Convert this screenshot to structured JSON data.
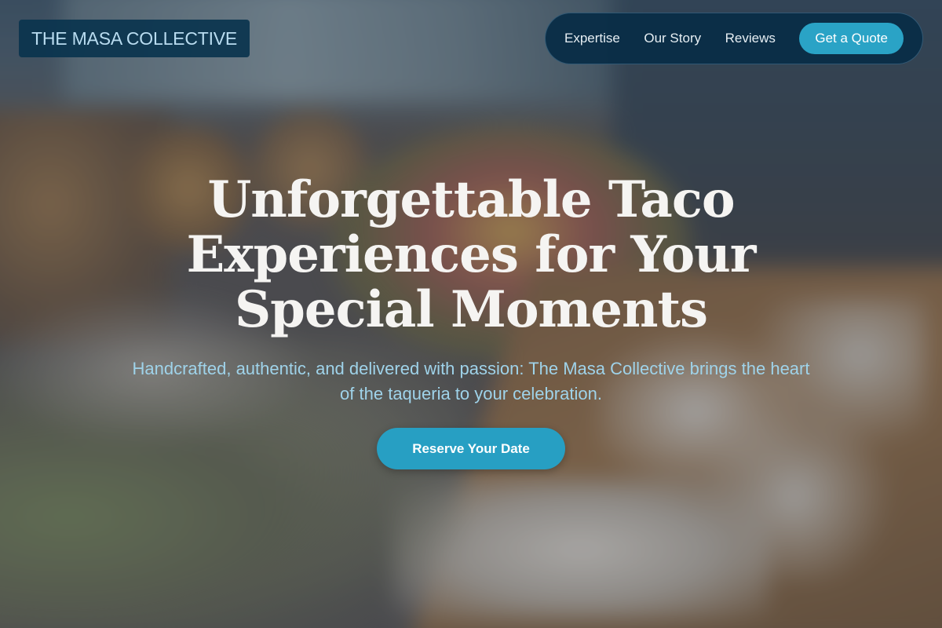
{
  "brand": {
    "logo_text": "THE MASA COLLECTIVE"
  },
  "nav": {
    "links": [
      "Expertise",
      "Our Story",
      "Reviews"
    ],
    "cta_label": "Get a Quote"
  },
  "hero": {
    "headline": "Unforgettable Taco Experiences for Your Special Moments",
    "subheadline": "Handcrafted, authentic, and delivered with passion: The Masa Collective brings the heart of the taqueria to your celebration.",
    "cta_label": "Reserve Your Date",
    "background_image": "banquet-table-photo"
  },
  "colors": {
    "accent": "#279fc3",
    "nav_bg": "#082d46",
    "logo_text": "#b9dcf0",
    "subheadline_text": "#9fd3ea"
  }
}
